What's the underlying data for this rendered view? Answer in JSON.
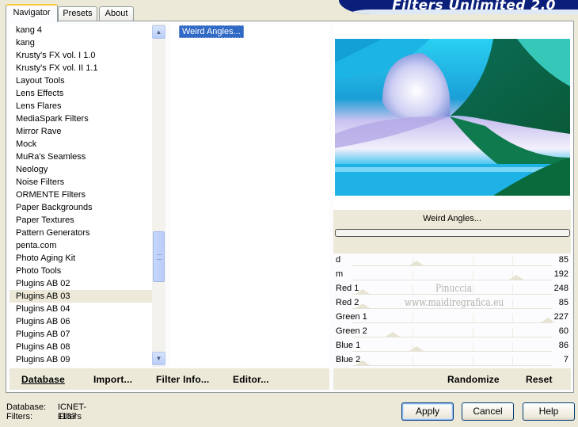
{
  "app": {
    "title": "Filters Unlimited 2.0"
  },
  "tabs": [
    {
      "label": "Navigator",
      "active": true
    },
    {
      "label": "Presets",
      "active": false
    },
    {
      "label": "About",
      "active": false
    }
  ],
  "categories": {
    "items": [
      "kang 4",
      "kang",
      "Krusty's FX vol. I 1.0",
      "Krusty's FX vol. II 1.1",
      "Layout Tools",
      "Lens Effects",
      "Lens Flares",
      "MediaSpark Filters",
      "Mirror Rave",
      "Mock",
      "MuRa's Seamless",
      "Neology",
      "Noise Filters",
      "ORMENTE Filters",
      "Paper Backgrounds",
      "Paper Textures",
      "Pattern Generators",
      "penta.com",
      "Photo Aging Kit",
      "Photo Tools",
      "Plugins AB 02",
      "Plugins AB 03",
      "Plugins AB 04",
      "Plugins AB 06",
      "Plugins AB 07",
      "Plugins AB 08",
      "Plugins AB 09"
    ],
    "selected": "Plugins AB 03",
    "scroll_position_fraction": 0.62
  },
  "filters": {
    "items": [
      "Weird Angles..."
    ],
    "selected": "Weird Angles..."
  },
  "left_buttons": {
    "database": "Database",
    "import": "Import...",
    "filter_info": "Filter Info...",
    "editor": "Editor..."
  },
  "preview": {
    "filter_name": "Weird Angles...",
    "progress": 0.0
  },
  "params": [
    {
      "label": "d",
      "value": "85"
    },
    {
      "label": "m",
      "value": "192"
    },
    {
      "label": "Red 1",
      "value": "248"
    },
    {
      "label": "Red 2",
      "value": "85"
    },
    {
      "label": "Green 1",
      "value": "227"
    },
    {
      "label": "Green 2",
      "value": "60"
    },
    {
      "label": "Blue 1",
      "value": "86"
    },
    {
      "label": "Blue 2",
      "value": "7"
    }
  ],
  "watermark": {
    "line1": "Pinuccia",
    "line2": "www.maidiregrafica.eu"
  },
  "right_buttons": {
    "randomize": "Randomize",
    "reset": "Reset"
  },
  "status": {
    "database_label": "Database:",
    "database_value": "ICNET-Filters",
    "filters_label": "Filters:",
    "filters_value": "1137"
  },
  "dialog_buttons": {
    "apply": "Apply",
    "cancel": "Cancel",
    "help": "Help"
  }
}
